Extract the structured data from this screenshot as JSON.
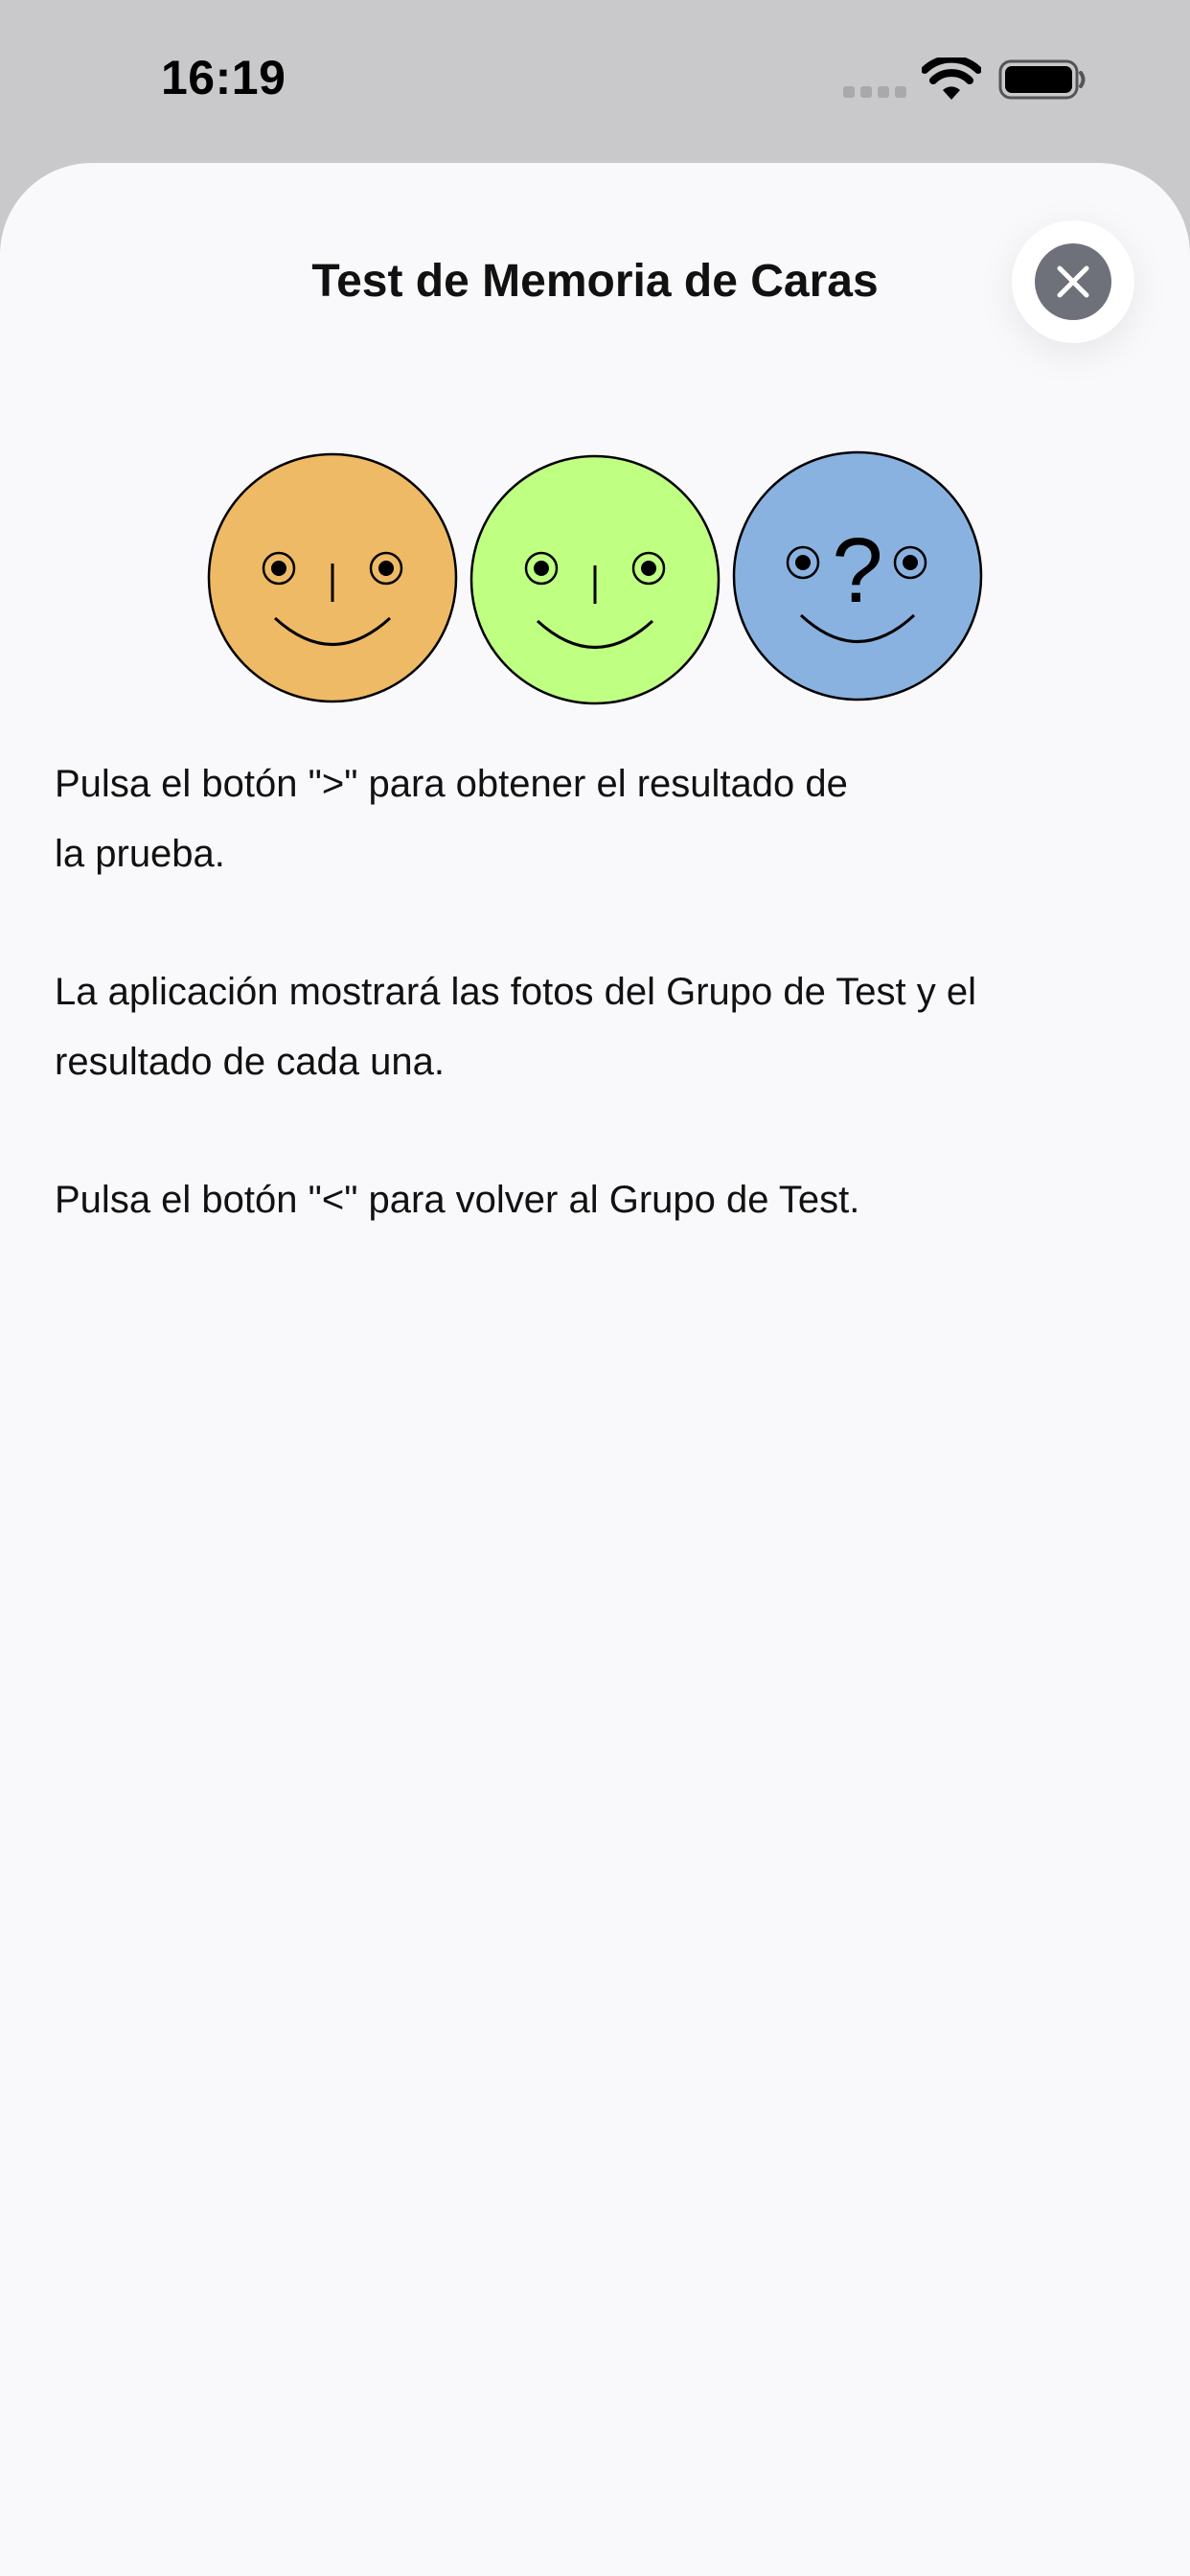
{
  "status_bar": {
    "time": "16:19",
    "icons": [
      "cellular-signal-icon",
      "wifi-icon",
      "battery-icon"
    ]
  },
  "sheet": {
    "title": "Test de Memoria de Caras",
    "close_icon": "close-icon"
  },
  "illustration": {
    "faces": [
      {
        "name": "face-orange",
        "color": "#efba66"
      },
      {
        "name": "face-green",
        "color": "#bfff82"
      },
      {
        "name": "face-blue",
        "color": "#8ab2e0",
        "symbol": "?"
      }
    ]
  },
  "instructions": {
    "p1_line1": "Pulsa el botón \">\" para obtener el resultado de",
    "p1_line2": "la prueba.",
    "p2": "La aplicación mostrará las fotos del Grupo de Test y el resultado de cada una.",
    "p3": "Pulsa el botón \"<\" para volver al Grupo de Test."
  }
}
